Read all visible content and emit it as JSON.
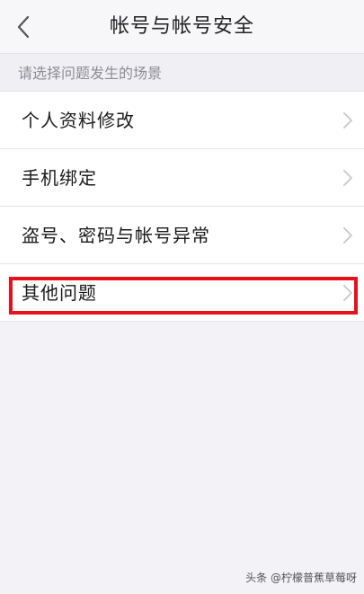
{
  "header": {
    "title": "帐号与帐号安全",
    "back_icon": "chevron-left-icon"
  },
  "section": {
    "title": "请选择问题发生的场景"
  },
  "items": [
    {
      "label": "个人资料修改",
      "icon": "chevron-right-icon"
    },
    {
      "label": "手机绑定",
      "icon": "chevron-right-icon"
    },
    {
      "label": "盗号、密码与帐号异常",
      "icon": "chevron-right-icon"
    },
    {
      "label": "其他问题",
      "icon": "chevron-right-icon",
      "highlighted": true
    }
  ],
  "watermark": "头条 @柠檬普蕉草莓呀",
  "colors": {
    "highlight": "#e5121d",
    "chevron": "#c7c7cc",
    "background": "#f3f2f7"
  }
}
